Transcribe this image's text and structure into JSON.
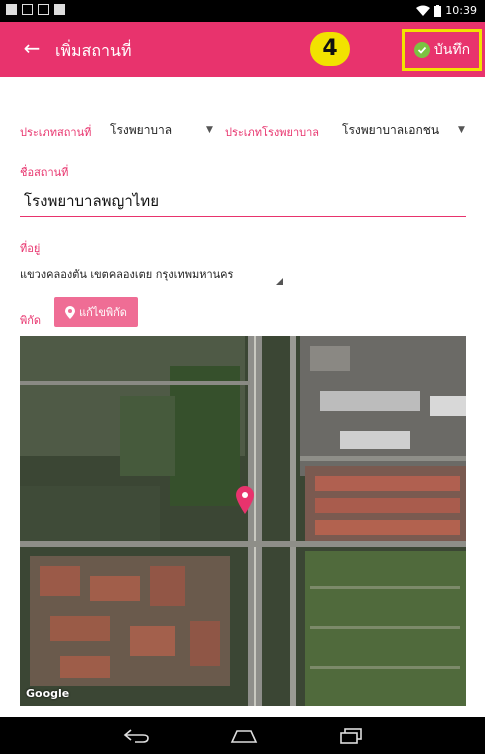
{
  "status_bar": {
    "time": "10:39"
  },
  "app_bar": {
    "title": "เพิ่มสถานที่",
    "step_badge": "4",
    "save_label": "บันทึก"
  },
  "form": {
    "place_type_label": "ประเภทสถานที่",
    "place_type_value": "โรงพยาบาล",
    "hospital_type_label": "ประเภทโรงพยาบาล",
    "hospital_type_value": "โรงพยาบาลเอกชน",
    "place_name_label": "ชื่อสถานที่",
    "place_name_value": "โรงพยาบาลพญาไทย",
    "address_label": "ที่อยู่",
    "address_value": "แขวงคลองตัน เขตคลองเตย กรุงเทพมหานคร",
    "coords_label": "พิกัด",
    "edit_coords_label": "แก้ไขพิกัด"
  },
  "map": {
    "attribution": "Google"
  },
  "colors": {
    "accent": "#e8336d",
    "highlight": "#f2e200",
    "save_check": "#7cc242"
  }
}
